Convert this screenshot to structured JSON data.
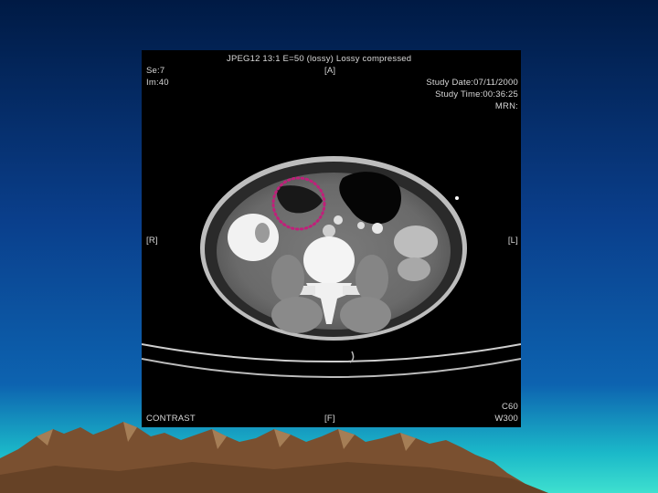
{
  "slide": {
    "background_top": "#001a44",
    "background_mid": "#0a3f8c",
    "background_horizon": "#1bd3c9",
    "mountain_color": "#7a5030"
  },
  "ct_overlay": {
    "header": "JPEG12 13:1 E=50 (lossy)   Lossy compressed",
    "orientation_top": "[A]",
    "series": "Se:7",
    "image": "Im:40",
    "study_date": "Study Date:07/11/2000",
    "study_time": "Study Time:00:36:25",
    "mrn": "MRN:",
    "orientation_left": "[R]",
    "orientation_right": "[L]",
    "contrast": "CONTRAST",
    "orientation_bottom": "[F]",
    "window_center": "C60",
    "window_width": "W300"
  },
  "annotation": {
    "type": "dotted-circle",
    "color": "#c0207a"
  }
}
